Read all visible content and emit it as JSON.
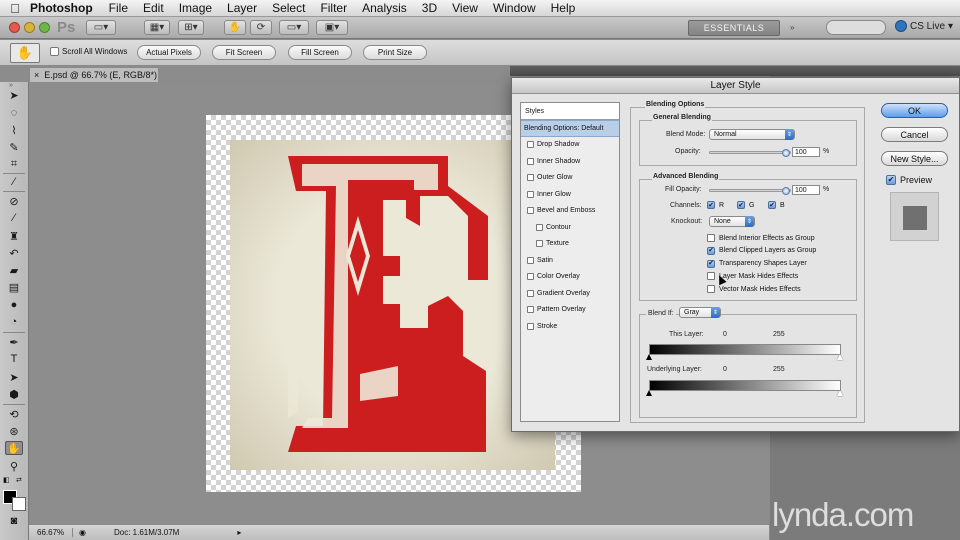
{
  "menubar": {
    "apple_icon": "apple-icon",
    "app_name": "Photoshop",
    "items": [
      "File",
      "Edit",
      "Image",
      "Layer",
      "Select",
      "Filter",
      "Analysis",
      "3D",
      "View",
      "Window",
      "Help"
    ]
  },
  "appbar": {
    "logo": "Ps",
    "workspace": "ESSENTIALS",
    "cs_live": "CS Live"
  },
  "options": {
    "scroll_all_windows": "Scroll All Windows",
    "buttons": [
      "Actual Pixels",
      "Fit Screen",
      "Fill Screen",
      "Print Size"
    ]
  },
  "document": {
    "tab_close": "×",
    "tab_title": "E.psd @ 66.7% (E, RGB/8*)",
    "tab_modified": "°",
    "zoom": "66.67%",
    "doc_info": "Doc: 1.61M/3.07M",
    "letter_color": "#cc1e1e"
  },
  "dialog": {
    "title": "Layer Style",
    "styles_header": "Styles",
    "style_items": [
      {
        "label": "Blending Options: Default",
        "selected": true,
        "checkbox": false,
        "sub": false
      },
      {
        "label": "Drop Shadow",
        "checkbox": true,
        "sub": false
      },
      {
        "label": "Inner Shadow",
        "checkbox": true,
        "sub": false
      },
      {
        "label": "Outer Glow",
        "checkbox": true,
        "sub": false
      },
      {
        "label": "Inner Glow",
        "checkbox": true,
        "sub": false
      },
      {
        "label": "Bevel and Emboss",
        "checkbox": true,
        "sub": false
      },
      {
        "label": "Contour",
        "checkbox": true,
        "sub": true
      },
      {
        "label": "Texture",
        "checkbox": true,
        "sub": true
      },
      {
        "label": "Satin",
        "checkbox": true,
        "sub": false
      },
      {
        "label": "Color Overlay",
        "checkbox": true,
        "sub": false
      },
      {
        "label": "Gradient Overlay",
        "checkbox": true,
        "sub": false
      },
      {
        "label": "Pattern Overlay",
        "checkbox": true,
        "sub": false
      },
      {
        "label": "Stroke",
        "checkbox": true,
        "sub": false
      }
    ],
    "blending_options": "Blending Options",
    "general_blending": "General Blending",
    "blend_mode_label": "Blend Mode:",
    "blend_mode_value": "Normal",
    "opacity_label": "Opacity:",
    "opacity_value": "100",
    "percent": "%",
    "advanced_blending": "Advanced Blending",
    "fill_opacity_label": "Fill Opacity:",
    "fill_opacity_value": "100",
    "channels_label": "Channels:",
    "channels": [
      "R",
      "G",
      "B"
    ],
    "knockout_label": "Knockout:",
    "knockout_value": "None",
    "options": [
      {
        "label": "Blend Interior Effects as Group",
        "checked": false
      },
      {
        "label": "Blend Clipped Layers as Group",
        "checked": true
      },
      {
        "label": "Transparency Shapes Layer",
        "checked": true
      },
      {
        "label": "Layer Mask Hides Effects",
        "checked": false
      },
      {
        "label": "Vector Mask Hides Effects",
        "checked": false
      }
    ],
    "blend_if_label": "Blend If:",
    "blend_if_value": "Gray",
    "this_layer_label": "This Layer:",
    "this_layer_min": "0",
    "this_layer_max": "255",
    "underlying_layer_label": "Underlying Layer:",
    "underlying_min": "0",
    "underlying_max": "255",
    "ok": "OK",
    "cancel": "Cancel",
    "new_style": "New Style...",
    "preview_label": "Preview",
    "preview_checked": true
  },
  "watermark": "lynda.com"
}
